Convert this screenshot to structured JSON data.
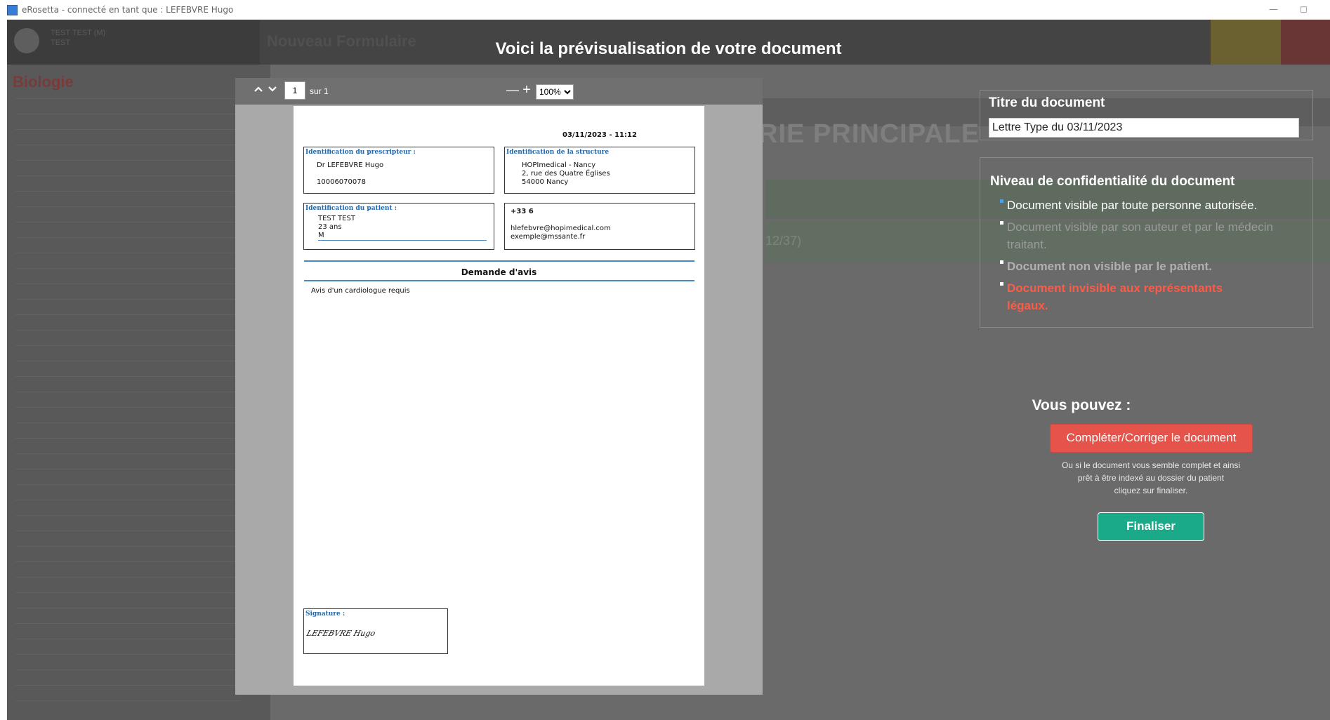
{
  "window": {
    "title": "eRosetta - connecté en tant que : LEFEBVRE Hugo",
    "minimize": "—",
    "maximize": "◻"
  },
  "background": {
    "user_name": "TEST TEST (M)",
    "user_sub": "TEST",
    "form_title": "Nouveau Formulaire",
    "sidebar_heading": "Biologie",
    "big_section": "RIE PRINCIPALE",
    "green_text": "12/37)"
  },
  "modal": {
    "title": "Voici la prévisualisation de votre document"
  },
  "viewer": {
    "prev_icon": "chevron-up-icon",
    "next_icon": "chevron-down-icon",
    "page_current": "1",
    "page_total_label": "sur 1",
    "zoom_out": "—",
    "zoom_in": "+",
    "zoom_value": "100%"
  },
  "document": {
    "date": "03/11/2023 - 11:12",
    "prescriber": {
      "label": "Identification du prescripteur :",
      "name": "Dr LEFEBVRE Hugo",
      "id": "10006070078"
    },
    "structure": {
      "label": "Identification de la structure",
      "name": "HOPImedical - Nancy",
      "address1": "2, rue des Quatre Églises",
      "address2": "54000 Nancy"
    },
    "patient": {
      "label": "Identification du patient :",
      "name": "TEST TEST",
      "age": "23 ans",
      "sex": "M"
    },
    "contact": {
      "phone": "+33 6",
      "email1": "hlefebvre@hopimedical.com",
      "email2": "exemple@mssante.fr"
    },
    "section_title": "Demande d'avis",
    "body_text": "Avis d'un cardiologue requis",
    "signature_label": "Signature :",
    "signature_text": "LEFEBVRE Hugo"
  },
  "title_panel": {
    "heading": "Titre du document",
    "value": "Lettre Type du 03/11/2023"
  },
  "confidentiality": {
    "heading": "Niveau de confidentialité du document",
    "items": [
      {
        "text": "Document visible par toute personne autorisée.",
        "color": "#ffffff",
        "bullet": "#4a9fe0"
      },
      {
        "text": "Document visible par son auteur et par le médecin traitant.",
        "color": "#9a9a9a",
        "bullet": "#ffffff"
      },
      {
        "text": "Document non visible par le patient.",
        "color": "#b0b0b0",
        "bullet": "#ffffff"
      },
      {
        "text": "Document invisible aux représentants légaux.",
        "color": "#ff5a45",
        "bullet": "#ffffff"
      }
    ]
  },
  "actions": {
    "heading": "Vous pouvez :",
    "complete_label": "Compléter/Corriger le document",
    "help_line1": "Ou si le document vous semble complet et ainsi",
    "help_line2": "prêt à être indexé au dossier du patient",
    "help_line3": "cliquez sur finaliser.",
    "finalize_label": "Finaliser"
  }
}
